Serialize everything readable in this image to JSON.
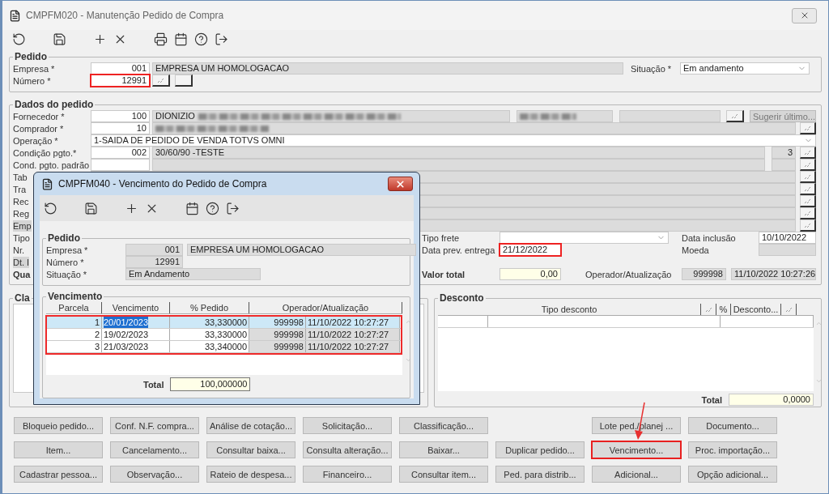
{
  "window": {
    "title": "CMPFM020 - Manutenção Pedido de Compra"
  },
  "toolbar": [
    {
      "kind": "refresh"
    },
    {
      "kind": "save"
    },
    {
      "kind": "add"
    },
    {
      "kind": "delete"
    },
    {
      "kind": "print"
    },
    {
      "kind": "calendar"
    },
    {
      "kind": "help"
    },
    {
      "kind": "exit"
    }
  ],
  "pedido": {
    "title": "Pedido",
    "empresa": {
      "label": "Empresa *",
      "code": "001",
      "name": "EMPRESA UM HOMOLOGACAO"
    },
    "numero": {
      "label": "Número *",
      "value": "12991",
      "highlighted": true
    },
    "situacao": {
      "label": "Situação *",
      "value": "Em andamento"
    }
  },
  "dados": {
    "title": "Dados do pedido",
    "fornecedor": {
      "label": "Fornecedor *",
      "code": "100",
      "name": "DIONIZIO",
      "button": "Sugerir último..."
    },
    "comprador": {
      "label": "Comprador *",
      "code": "10"
    },
    "operacao": {
      "label": "Operação *",
      "value": "1-SAIDA DE PEDIDO DE VENDA TOTVS OMNI"
    },
    "condicao": {
      "label": "Condição pgto.*",
      "code": "002",
      "name": "30/60/90 -TESTE",
      "parcelas": "3"
    },
    "cond_padrao": {
      "label": "Cond. pgto. padrão"
    },
    "hidden_rows": [
      {
        "label": "Tab",
        "kind": "plain"
      },
      {
        "label": "Tra",
        "kind": "plain"
      },
      {
        "label": "Rec",
        "kind": "plain"
      },
      {
        "label": "Reg",
        "kind": "plain"
      },
      {
        "label": "Emp",
        "kind": "shaded"
      }
    ],
    "lower_labels": [
      {
        "label": "Tipo",
        "kind": "plain"
      },
      {
        "label": "Nr.",
        "kind": "plain"
      },
      {
        "label": "Dt. I",
        "kind": "shaded"
      },
      {
        "label": "Qua",
        "kind": "bold"
      }
    ],
    "tipo_frete": {
      "label": "Tipo frete"
    },
    "data_prev": {
      "label": "Data prev. entrega",
      "value": "21/12/2022",
      "highlighted": true
    },
    "data_inclusao": {
      "label": "Data inclusão",
      "value": "10/10/2022"
    },
    "moeda": {
      "label": "Moeda"
    },
    "valor_total": {
      "label": "Valor total",
      "value": "0,00"
    },
    "operador": {
      "label": "Operador/Atualização",
      "code": "999998",
      "timestamp": "11/10/2022 10:27:26"
    }
  },
  "classificacao": {
    "title": "Cla"
  },
  "desconto": {
    "title": "Desconto",
    "columns": [
      "Tipo desconto",
      "%",
      "Desconto..."
    ],
    "total_label": "Total",
    "total": "0,0000"
  },
  "button_rows": [
    {
      "left": [
        {
          "label": "Bloqueio pedido...",
          "highlighted": false
        },
        {
          "label": "Conf. N.F. compra...",
          "highlighted": false
        },
        {
          "label": "Análise de cotação...",
          "highlighted": false
        },
        {
          "label": "Solicitação...",
          "highlighted": false
        },
        {
          "label": "Classificação...",
          "highlighted": false
        }
      ],
      "right": [
        {
          "label": "Lote ped./planej ...",
          "highlighted": false
        },
        {
          "label": "Documento...",
          "highlighted": false
        }
      ]
    },
    {
      "left": [
        {
          "label": "Item...",
          "highlighted": false
        },
        {
          "label": "Cancelamento...",
          "highlighted": false
        },
        {
          "label": "Consultar baixa...",
          "highlighted": false
        },
        {
          "label": "Consulta alteração...",
          "highlighted": false
        },
        {
          "label": "Baixar...",
          "highlighted": false
        },
        {
          "label": "Duplicar pedido...",
          "highlighted": false
        }
      ],
      "right": [
        {
          "label": "Vencimento...",
          "highlighted": true
        },
        {
          "label": "Proc. importação...",
          "highlighted": false
        }
      ]
    },
    {
      "left": [
        {
          "label": "Cadastrar pessoa...",
          "highlighted": false
        },
        {
          "label": "Observação...",
          "highlighted": false
        },
        {
          "label": "Rateio de despesa...",
          "highlighted": false
        },
        {
          "label": "Financeiro...",
          "highlighted": false
        },
        {
          "label": "Consultar item...",
          "highlighted": false
        },
        {
          "label": "Ped. para distrib...",
          "highlighted": false
        }
      ],
      "right": [
        {
          "label": "Adicional...",
          "highlighted": false
        },
        {
          "label": "Opção adicional...",
          "highlighted": false
        }
      ]
    }
  ],
  "dialog": {
    "title": "CMPFM040 - Vencimento do Pedido de Compra",
    "toolbar": [
      {
        "kind": "refresh"
      },
      {
        "kind": "save"
      },
      {
        "kind": "add"
      },
      {
        "kind": "delete"
      },
      {
        "kind": "calendar"
      },
      {
        "kind": "help"
      },
      {
        "kind": "exit"
      }
    ],
    "pedido": {
      "title": "Pedido",
      "empresa_label": "Empresa *",
      "empresa_code": "001",
      "empresa_name": "EMPRESA UM HOMOLOGACAO",
      "numero_label": "Número *",
      "numero": "12991",
      "situacao_label": "Situação *",
      "situacao": "Em Andamento"
    },
    "vencimento": {
      "title": "Vencimento",
      "columns": [
        "Parcela",
        "Vencimento",
        "% Pedido",
        "Operador/Atualização"
      ],
      "highlighted": true,
      "rows": [
        {
          "parcela": "1",
          "vencimento": "20/01/2023",
          "pedido": "33,330000",
          "operador": "999998",
          "atualizacao": "11/10/2022 10:27:27",
          "selected": true
        },
        {
          "parcela": "2",
          "vencimento": "19/02/2023",
          "pedido": "33,330000",
          "operador": "999998",
          "atualizacao": "11/10/2022 10:27:27",
          "selected": false
        },
        {
          "parcela": "3",
          "vencimento": "21/03/2023",
          "pedido": "33,340000",
          "operador": "999998",
          "atualizacao": "11/10/2022 10:27:27",
          "selected": false
        }
      ],
      "total_label": "Total",
      "total": "100,000000"
    }
  }
}
